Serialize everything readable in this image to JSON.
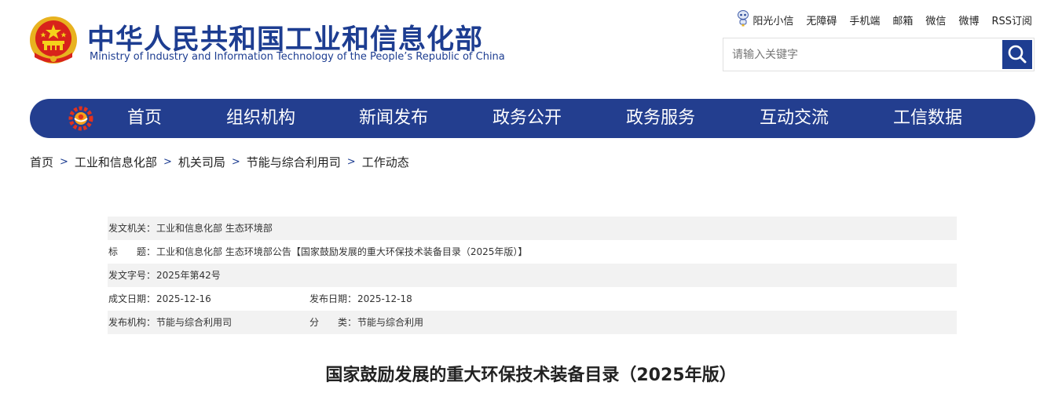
{
  "header": {
    "title_cn": "中华人民共和国工业和信息化部",
    "title_en": "Ministry of Industry and Information Technology of the People’s Republic of China",
    "emblem_icon": "national-emblem",
    "brand_color": "#1d3d91"
  },
  "top_links": [
    {
      "label": "阳光小信",
      "icon": "robot-icon"
    },
    {
      "label": "无障碍"
    },
    {
      "label": "手机端"
    },
    {
      "label": "邮箱"
    },
    {
      "label": "微信"
    },
    {
      "label": "微博"
    },
    {
      "label": "RSS订阅"
    }
  ],
  "search": {
    "placeholder": "请输入关键字",
    "button_icon": "search-icon"
  },
  "nav": {
    "background": "#233e8f",
    "items": [
      "首页",
      "组织机构",
      "新闻发布",
      "政务公开",
      "政务服务",
      "互动交流",
      "工信数据"
    ]
  },
  "breadcrumb": [
    "首页",
    "工业和信息化部",
    "机关司局",
    "节能与综合利用司",
    "工作动态"
  ],
  "meta": {
    "issuer_label": "发文机关：",
    "issuer_value": "工业和信息化部 生态环境部",
    "title_label": "标　　题：",
    "title_value": "工业和信息化部 生态环境部公告【国家鼓励发展的重大环保技术装备目录（2025年版）】",
    "docno_label": "发文字号：",
    "docno_value": "2025年第42号",
    "created_label": "成文日期：",
    "created_value": "2025-12-16",
    "published_label": "发布日期：",
    "published_value": "2025-12-18",
    "org_label": "发布机构：",
    "org_value": "节能与综合利用司",
    "category_label": "分　　类：",
    "category_value": "节能与综合利用"
  },
  "document_title": "国家鼓励发展的重大环保技术装备目录（2025年版）"
}
